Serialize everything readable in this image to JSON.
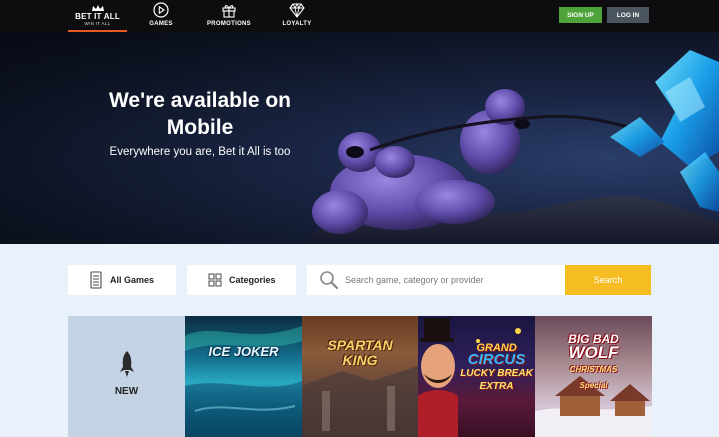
{
  "header": {
    "logo": {
      "brand": "BET IT ALL",
      "tagline": "WIN IT ALL",
      "icon": "crown-icon"
    },
    "nav": [
      {
        "label": "GAMES",
        "icon": "play-circle-icon"
      },
      {
        "label": "PROMOTIONS",
        "icon": "gift-icon"
      },
      {
        "label": "LOYALTY",
        "icon": "diamond-icon"
      }
    ],
    "signup_label": "SIGN UP",
    "login_label": "LOG IN"
  },
  "hero": {
    "title_line1": "We're available on",
    "title_line2": "Mobile",
    "subtitle": "Everywhere you are, Bet it All is too"
  },
  "filters": {
    "all_games_label": "All Games",
    "all_games_icon": "phone-grid-icon",
    "categories_label": "Categories",
    "categories_icon": "grid-icon",
    "search_placeholder": "Search game, category or provider",
    "search_icon": "search-icon",
    "search_button_label": "Search"
  },
  "games": {
    "new_label": "NEW",
    "new_icon": "rocket-icon",
    "tiles": [
      {
        "title": "ICE JOKER"
      },
      {
        "title_line1": "SPARTAN",
        "title_line2": "KING"
      },
      {
        "title_line1": "GRAND",
        "title_line2": "CIRCUS",
        "title_line3": "LUCKY BREAK",
        "title_line4": "EXTRA"
      },
      {
        "title_line1": "BIG BAD",
        "title_line2": "WOLF",
        "title_line3": "CHRISTMAS",
        "title_line4": "Special"
      }
    ]
  },
  "colors": {
    "topbar": "#0d0d0f",
    "signup": "#4fa33b",
    "login": "#4a5560",
    "search_button": "#f6bd22",
    "page_bg": "#e9f1fa",
    "logo_underline": "#e85a1e"
  }
}
